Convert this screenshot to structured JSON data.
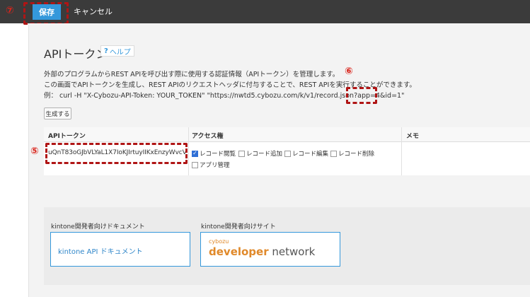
{
  "toolbar": {
    "save_label": "保存",
    "cancel_label": "キャンセル"
  },
  "markers": {
    "m5": "⑤",
    "m6": "⑥",
    "m7": "⑦"
  },
  "header": {
    "title": "APIトークン",
    "help_icon": "?",
    "help_label": "ヘルプ"
  },
  "description": {
    "line1": "外部のプログラムからREST APIを呼び出す際に使用する認証情報（APIトークン）を管理します。",
    "line2": "この画面でAPIトークンを生成し、REST APIのリクエストヘッダに付与することで、REST APIを実行することができます。",
    "line3": "例： curl -H \"X-Cybozu-API-Token: YOUR_TOKEN\" \"https://nwtd5.cybozu.com/k/v1/record.json?app=4&id=1\""
  },
  "generate_label": "生成する",
  "table": {
    "headers": {
      "token": "APIトークン",
      "access": "アクセス権",
      "memo": "メモ"
    },
    "token_value": "uQnT83oGJbVLYaL1X7IoKJIrtuyIIKxEnzyWvcV",
    "permissions": [
      {
        "label": "レコード閲覧",
        "checked": true
      },
      {
        "label": "レコード追加",
        "checked": false
      },
      {
        "label": "レコード編集",
        "checked": false
      },
      {
        "label": "レコード削除",
        "checked": false
      },
      {
        "label": "アプリ管理",
        "checked": false
      }
    ]
  },
  "links": {
    "docs_label": "kintone開発者向けドキュメント",
    "docs_link": "kintone API ドキュメント",
    "site_label": "kintone開発者向けサイト",
    "site_brand_small": "cybozu",
    "site_brand_developer": "developer",
    "site_brand_network": " network"
  },
  "colors": {
    "accent": "#3498db",
    "marker_red": "#b01515",
    "topbar": "#3b3b3b",
    "brand_orange": "#e0892a"
  }
}
